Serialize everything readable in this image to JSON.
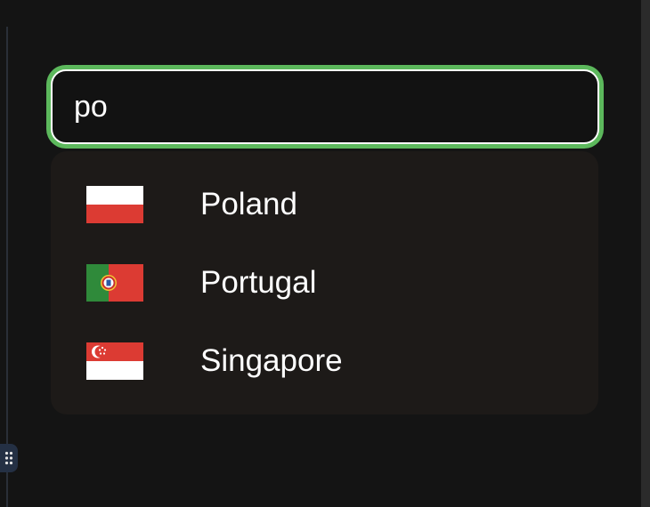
{
  "search": {
    "value": "po"
  },
  "options": [
    {
      "label": "Poland",
      "flag_icon": "poland-flag-icon"
    },
    {
      "label": "Portugal",
      "flag_icon": "portugal-flag-icon"
    },
    {
      "label": "Singapore",
      "flag_icon": "singapore-flag-icon"
    }
  ],
  "colors": {
    "focus_ring": "#5cb85c",
    "background": "#141414",
    "dropdown_bg": "#1d1a18",
    "text": "#ffffff"
  }
}
